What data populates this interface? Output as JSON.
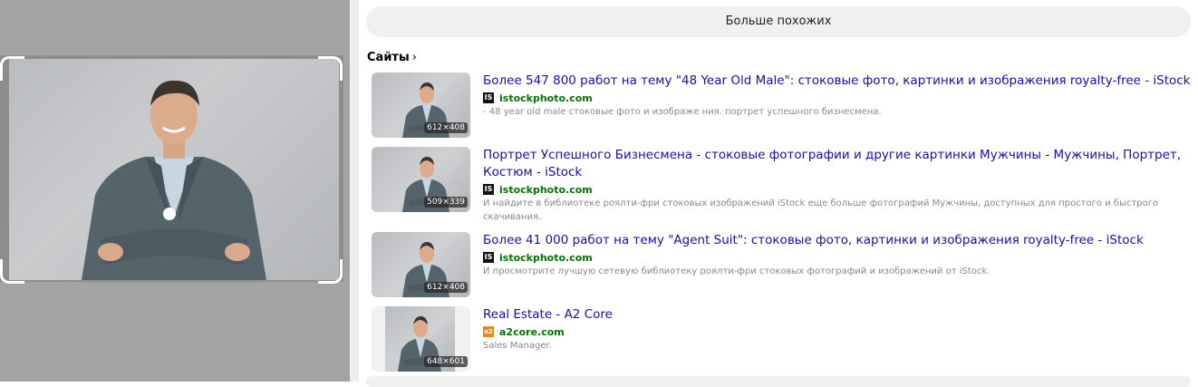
{
  "colors": {
    "link": "#1a0dab",
    "source": "#007700",
    "snippet": "#888888",
    "left_panel_bg": "#a3a3a3"
  },
  "more_button_label": "Больше похожих",
  "sites_heading": "Сайты",
  "sites_chevron": "›",
  "results": [
    {
      "title": "Более 547 800 работ на тему \"48 Year Old Male\": стоковые фото, картинки и изображения royalty-free - iStock",
      "source": "istockphoto.com",
      "favicon": "IS",
      "snippet": "- 48 year old male стоковые фото и изображе ния. портрет успешного бизнесмена.",
      "size": "612×408"
    },
    {
      "title": "Портрет Успешного Бизнесмена - стоковые фотографии и другие картинки Мужчины - Мужчины, Портрет, Костюм - iStock",
      "source": "istockphoto.com",
      "favicon": "IS",
      "snippet": "И найдите в библиотеке роялти-фри стоковых изображений iStock еще больше фотографий Мужчины, доступных для простого и быстрого скачивания.",
      "size": "509×339"
    },
    {
      "title": "Более 41 000 работ на тему \"Agent Suit\": стоковые фото, картинки и изображения royalty-free - iStock",
      "source": "istockphoto.com",
      "favicon": "IS",
      "snippet": "И просмотрите лучшую сетевую библиотеку роялти-фри стоковых фотографий и изображений от iStock.",
      "size": "612×408"
    },
    {
      "title": "Real Estate - A2 Core",
      "source": "a2core.com",
      "favicon": "a2",
      "snippet": "Sales Manager.",
      "size": "648×601"
    }
  ]
}
